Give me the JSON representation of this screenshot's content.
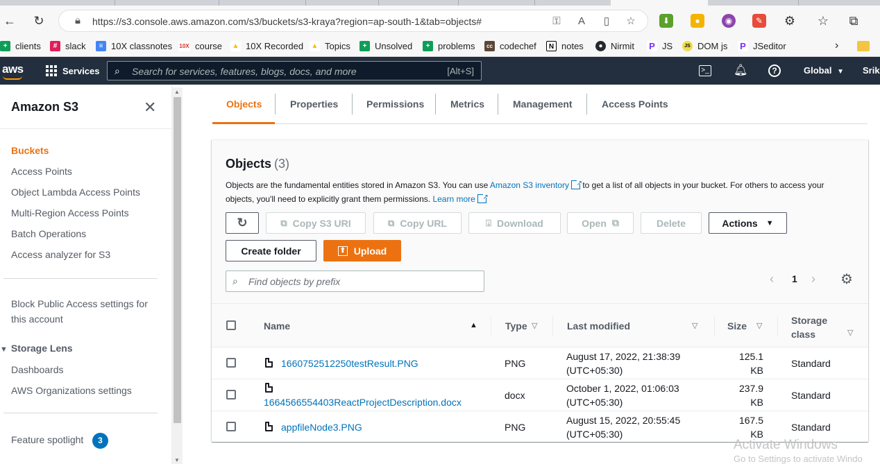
{
  "browser": {
    "url": "https://s3.console.aws.amazon.com/s3/buckets/s3-kraya?region=ap-south-1&tab=objects#",
    "bookmarks": [
      {
        "label": "clients",
        "color": "#0f9d58",
        "glyph": "+"
      },
      {
        "label": "slack",
        "color": "#e01e5a",
        "glyph": "#"
      },
      {
        "label": "10X classnotes",
        "color": "#4285f4",
        "glyph": "≡"
      },
      {
        "label": "course",
        "color": "#d93025",
        "glyph": "10X"
      },
      {
        "label": "10X Recorded",
        "color": "#fbbc04",
        "glyph": "▲"
      },
      {
        "label": "Topics",
        "color": "#fbbc04",
        "glyph": "▲"
      },
      {
        "label": "Unsolved",
        "color": "#0f9d58",
        "glyph": "+"
      },
      {
        "label": "problems",
        "color": "#0f9d58",
        "glyph": "+"
      },
      {
        "label": "codechef",
        "color": "#5b4638",
        "glyph": "cc"
      },
      {
        "label": "notes",
        "color": "#000000",
        "glyph": "N"
      },
      {
        "label": "Nirmit",
        "color": "#24292e",
        "glyph": "●"
      },
      {
        "label": "JS",
        "color": "#7b2ff7",
        "glyph": "P"
      },
      {
        "label": "DOM js",
        "color": "#f0db4f",
        "glyph": "JS"
      },
      {
        "label": "JSeditor",
        "color": "#7b2ff7",
        "glyph": "P"
      }
    ]
  },
  "awsnav": {
    "logo": "aws",
    "services_label": "Services",
    "search_placeholder": "Search for services, features, blogs, docs, and more",
    "search_shortcut": "[Alt+S]",
    "region_label": "Global",
    "user_label": "Srikr"
  },
  "sidebar": {
    "title": "Amazon S3",
    "items": [
      {
        "label": "Buckets",
        "active": true
      },
      {
        "label": "Access Points"
      },
      {
        "label": "Object Lambda Access Points"
      },
      {
        "label": "Multi-Region Access Points"
      },
      {
        "label": "Batch Operations"
      },
      {
        "label": "Access analyzer for S3"
      }
    ],
    "block_access_label_1": "Block Public Access settings for",
    "block_access_label_2": "this account",
    "storage_lens_label": "Storage Lens",
    "dashboards_label": "Dashboards",
    "org_settings_label": "AWS Organizations settings",
    "feature_spotlight_label": "Feature spotlight",
    "feature_spotlight_count": "3"
  },
  "tabs": [
    "Objects",
    "Properties",
    "Permissions",
    "Metrics",
    "Management",
    "Access Points"
  ],
  "panel": {
    "title": "Objects",
    "count": "(3)",
    "desc_1": "Objects are the fundamental entities stored in Amazon S3. You can use ",
    "desc_link_1": "Amazon S3 inventory",
    "desc_2": " to get a list of all objects in your bucket. For others to access your objects, you'll need to explicitly grant them permissions. ",
    "desc_link_2": "Learn more",
    "buttons": {
      "copy_uri": "Copy S3 URI",
      "copy_url": "Copy URL",
      "download": "Download",
      "open": "Open",
      "delete": "Delete",
      "actions": "Actions",
      "create_folder": "Create folder",
      "upload": "Upload"
    },
    "find_placeholder": "Find objects by prefix",
    "page_number": "1"
  },
  "table": {
    "headers": {
      "name": "Name",
      "type": "Type",
      "last_modified": "Last modified",
      "size": "Size",
      "storage_class_1": "Storage",
      "storage_class_2": "class"
    },
    "rows": [
      {
        "name": "1660752512250testResult.PNG",
        "type": "PNG",
        "modified_1": "August 17, 2022, 21:38:39",
        "modified_2": "(UTC+05:30)",
        "size_1": "125.1",
        "size_2": "KB",
        "storage_class": "Standard"
      },
      {
        "name": "1664566554403ReactProjectDescription.docx",
        "type": "docx",
        "modified_1": "October 1, 2022, 01:06:03",
        "modified_2": "(UTC+05:30)",
        "size_1": "237.9",
        "size_2": "KB",
        "storage_class": "Standard"
      },
      {
        "name": "appfileNode3.PNG",
        "type": "PNG",
        "modified_1": "August 15, 2022, 20:55:45",
        "modified_2": "(UTC+05:30)",
        "size_1": "167.5",
        "size_2": "KB",
        "storage_class": "Standard"
      }
    ]
  },
  "watermark": {
    "line_1": "Activate Windows",
    "line_2": "Go to Settings to activate Windo"
  }
}
